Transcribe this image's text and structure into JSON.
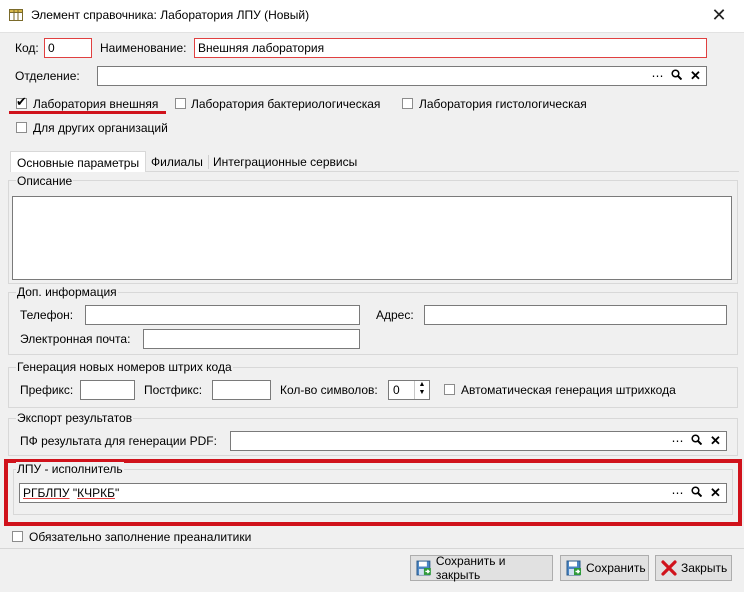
{
  "window": {
    "title": "Элемент справочника: Лаборатория ЛПУ (Новый)",
    "close_glyph": "✕"
  },
  "fields": {
    "code_label": "Код:",
    "code_value": "0",
    "name_label": "Наименование:",
    "name_value": "Внешняя лаборатория",
    "department_label": "Отделение:",
    "department_value": ""
  },
  "checkboxes": {
    "external": {
      "label": "Лаборатория внешняя",
      "checked": true
    },
    "bacterio": {
      "label": "Лаборатория бактериологическая",
      "checked": false
    },
    "histo": {
      "label": "Лаборатория гистологическая",
      "checked": false
    },
    "other_orgs": {
      "label": "Для других организаций",
      "checked": false
    }
  },
  "tabs": [
    "Основные параметры",
    "Филиалы",
    "Интеграционные сервисы"
  ],
  "description": {
    "label": "Описание",
    "value": ""
  },
  "extra_info": {
    "label": "Доп. информация",
    "phone_label": "Телефон:",
    "address_label": "Адрес:",
    "email_label": "Электронная почта:"
  },
  "barcode": {
    "label": "Генерация новых номеров штрих кода",
    "prefix_label": "Префикс:",
    "postfix_label": "Постфикс:",
    "count_label": "Кол-во символов:",
    "count_value": "0",
    "auto_label": "Автоматическая генерация штрихкода"
  },
  "export": {
    "label": "Экспорт результатов",
    "pdf_label": "ПФ результата для генерации PDF:",
    "pdf_value": ""
  },
  "executor": {
    "label": "ЛПУ - исполнитель",
    "value_part1": "РГБЛПУ",
    "value_part2": "\"",
    "value_part3": "КЧРКБ",
    "value_part4": "\""
  },
  "required_preanalytics": {
    "label": "Обязательно заполнение преаналитики",
    "checked": false
  },
  "buttons": {
    "save_close": "Сохранить и закрыть",
    "save": "Сохранить",
    "close": "Закрыть"
  },
  "icons": {
    "more": "⋯",
    "search": "search-icon",
    "clear": "✕"
  },
  "colors": {
    "error_border": "#e04040",
    "highlight": "#d0121b"
  }
}
